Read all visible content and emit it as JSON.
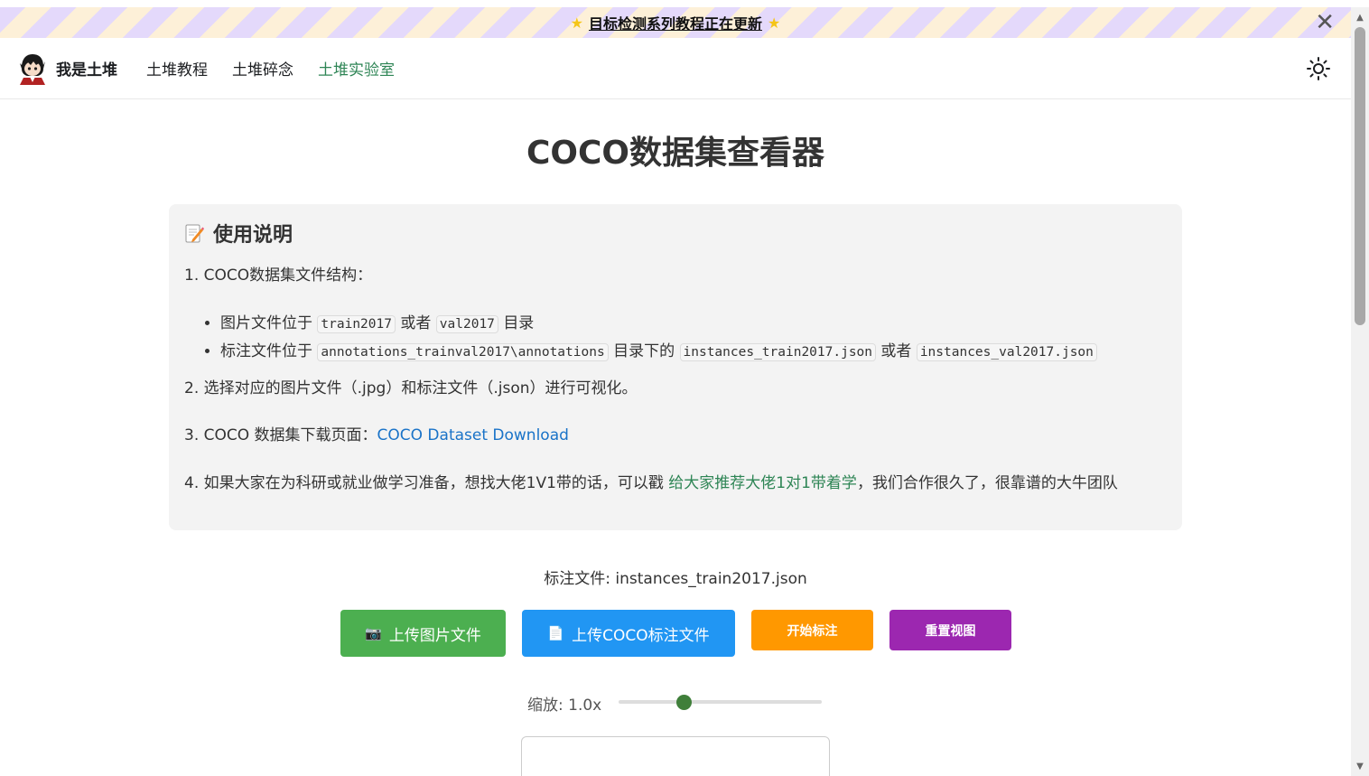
{
  "announcement": {
    "text": "目标检测系列教程正在更新",
    "star_icon": "star-icon",
    "close_icon": "close-icon"
  },
  "navbar": {
    "brand": "我是土堆",
    "links": [
      {
        "label": "土堆教程",
        "active": false
      },
      {
        "label": "土堆碎念",
        "active": false
      },
      {
        "label": "土堆实验室",
        "active": true
      }
    ],
    "theme_icon": "sun-icon"
  },
  "page": {
    "title": "COCO数据集查看器"
  },
  "instructions": {
    "title": "使用说明",
    "step1": "1. COCO数据集文件结构：",
    "files": {
      "images_prefix": "图片文件位于",
      "train_dir": "train2017",
      "or1": "或者",
      "val_dir": "val2017",
      "dir_suffix": "目录",
      "ann_prefix": "标注文件位于",
      "ann_dir": "annotations_trainval2017\\annotations",
      "ann_mid": "目录下的",
      "train_json": "instances_train2017.json",
      "or2": "或者",
      "val_json": "instances_val2017.json"
    },
    "step2": "2. 选择对应的图片文件（.jpg）和标注文件（.json）进行可视化。",
    "step3_prefix": "3. COCO 数据集下载页面：",
    "step3_link": "COCO Dataset Download",
    "step4_prefix": "4. 如果大家在为科研或就业做学习准备，想找大佬1V1带的话，可以戳",
    "step4_link": "给大家推荐大佬1对1带着学",
    "step4_suffix": "，我们合作很久了，很靠谱的大牛团队"
  },
  "status": {
    "annotation_file": "标注文件: instances_train2017.json"
  },
  "buttons": {
    "upload_image": "上传图片文件",
    "upload_coco": "上传COCO标注文件",
    "start_annotate": "开始标注",
    "reset_view": "重置视图"
  },
  "zoom": {
    "label": "缩放: 1.0x",
    "value": 1.0
  },
  "colors": {
    "accent_green": "#2e8555",
    "btn_green": "#4caf50",
    "btn_blue": "#2196f3",
    "btn_orange": "#ff9800",
    "btn_purple": "#9c27b0",
    "link_blue": "#1a73c8"
  }
}
